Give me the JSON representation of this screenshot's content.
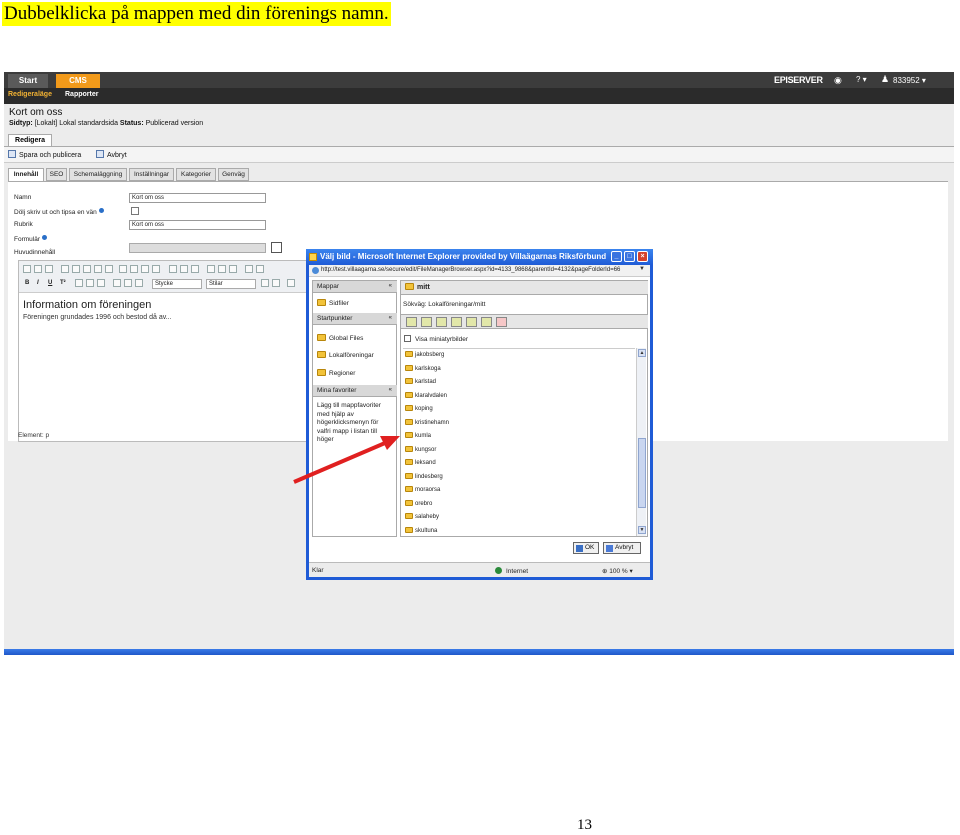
{
  "document": {
    "heading": "Dubbelklicka på mappen med din förenings namn.",
    "page_number": "13"
  },
  "cms": {
    "top_tabs": [
      "Start",
      "CMS"
    ],
    "brand": "EPISERVER",
    "user": "833952",
    "help": "?",
    "sub_tabs": [
      "Redigeraläge",
      "Rapporter"
    ],
    "page_title": "Kort om oss",
    "meta": {
      "type_label": "Sidtyp:",
      "type_value": "[Lokalt] Lokal standardsida",
      "status_label": "Status:",
      "status_value": "Publicerad version"
    },
    "mode_tab": "Redigera",
    "toolbar": {
      "save": "Spara och publicera",
      "cancel": "Avbryt"
    },
    "content_tabs": [
      "Innehåll",
      "SEO",
      "Schemaläggning",
      "Inställningar",
      "Kategorier",
      "Genväg"
    ],
    "fields": {
      "name_label": "Namn",
      "name_value": "Kort om oss",
      "hide_label": "Dölj skriv ut och tipsa en vän",
      "heading_label": "Rubrik",
      "heading_value": "Kort om oss",
      "form_label": "Formulär",
      "main_label": "Huvudinnehåll"
    },
    "editor": {
      "format_select": "Stycke",
      "style_select": "Stilar",
      "heading": "Information om föreningen",
      "paragraph": "Föreningen grundades 1996 och bestod då av...",
      "status": "Element: p"
    }
  },
  "dialog": {
    "title": "Välj bild - Microsoft Internet Explorer provided by Villaägarnas Riksförbund",
    "url": "http://test.villaagarna.se/secure/edit/FileManagerBrowser.aspx?id=4133_9868&parentId=4132&pageFolderId=66",
    "left": {
      "folders_header": "Mappar",
      "page_files": "Sidfiler",
      "startpoints_header": "Startpunkter",
      "startpoints": [
        "Global Files",
        "Lokalföreningar",
        "Regioner"
      ],
      "favorites_header": "Mina favoriter",
      "favorites_help": "Lägg till mappfavoriter med hjälp av högerklicksmenyn för valfri mapp i listan till höger"
    },
    "right": {
      "header": "mitt",
      "path": "Sökväg: Lokalföreningar/mitt",
      "thumbnails": "Visa miniatyrbilder",
      "folders": [
        "jakobsberg",
        "karlskoga",
        "karlstad",
        "klaralvdalen",
        "koping",
        "kristinehamn",
        "kumla",
        "kungsor",
        "leksand",
        "lindesberg",
        "moraorsa",
        "orebro",
        "salaheby",
        "skultuna"
      ]
    },
    "ok": "OK",
    "cancel": "Avbryt",
    "status_left": "Klar",
    "status_zone": "Internet",
    "zoom": "100 %"
  },
  "colors": {
    "highlight": "#ffff00",
    "cms_accent": "#f29a1a",
    "ie_title": "#1f5bd6",
    "arrow": "#e02020"
  }
}
